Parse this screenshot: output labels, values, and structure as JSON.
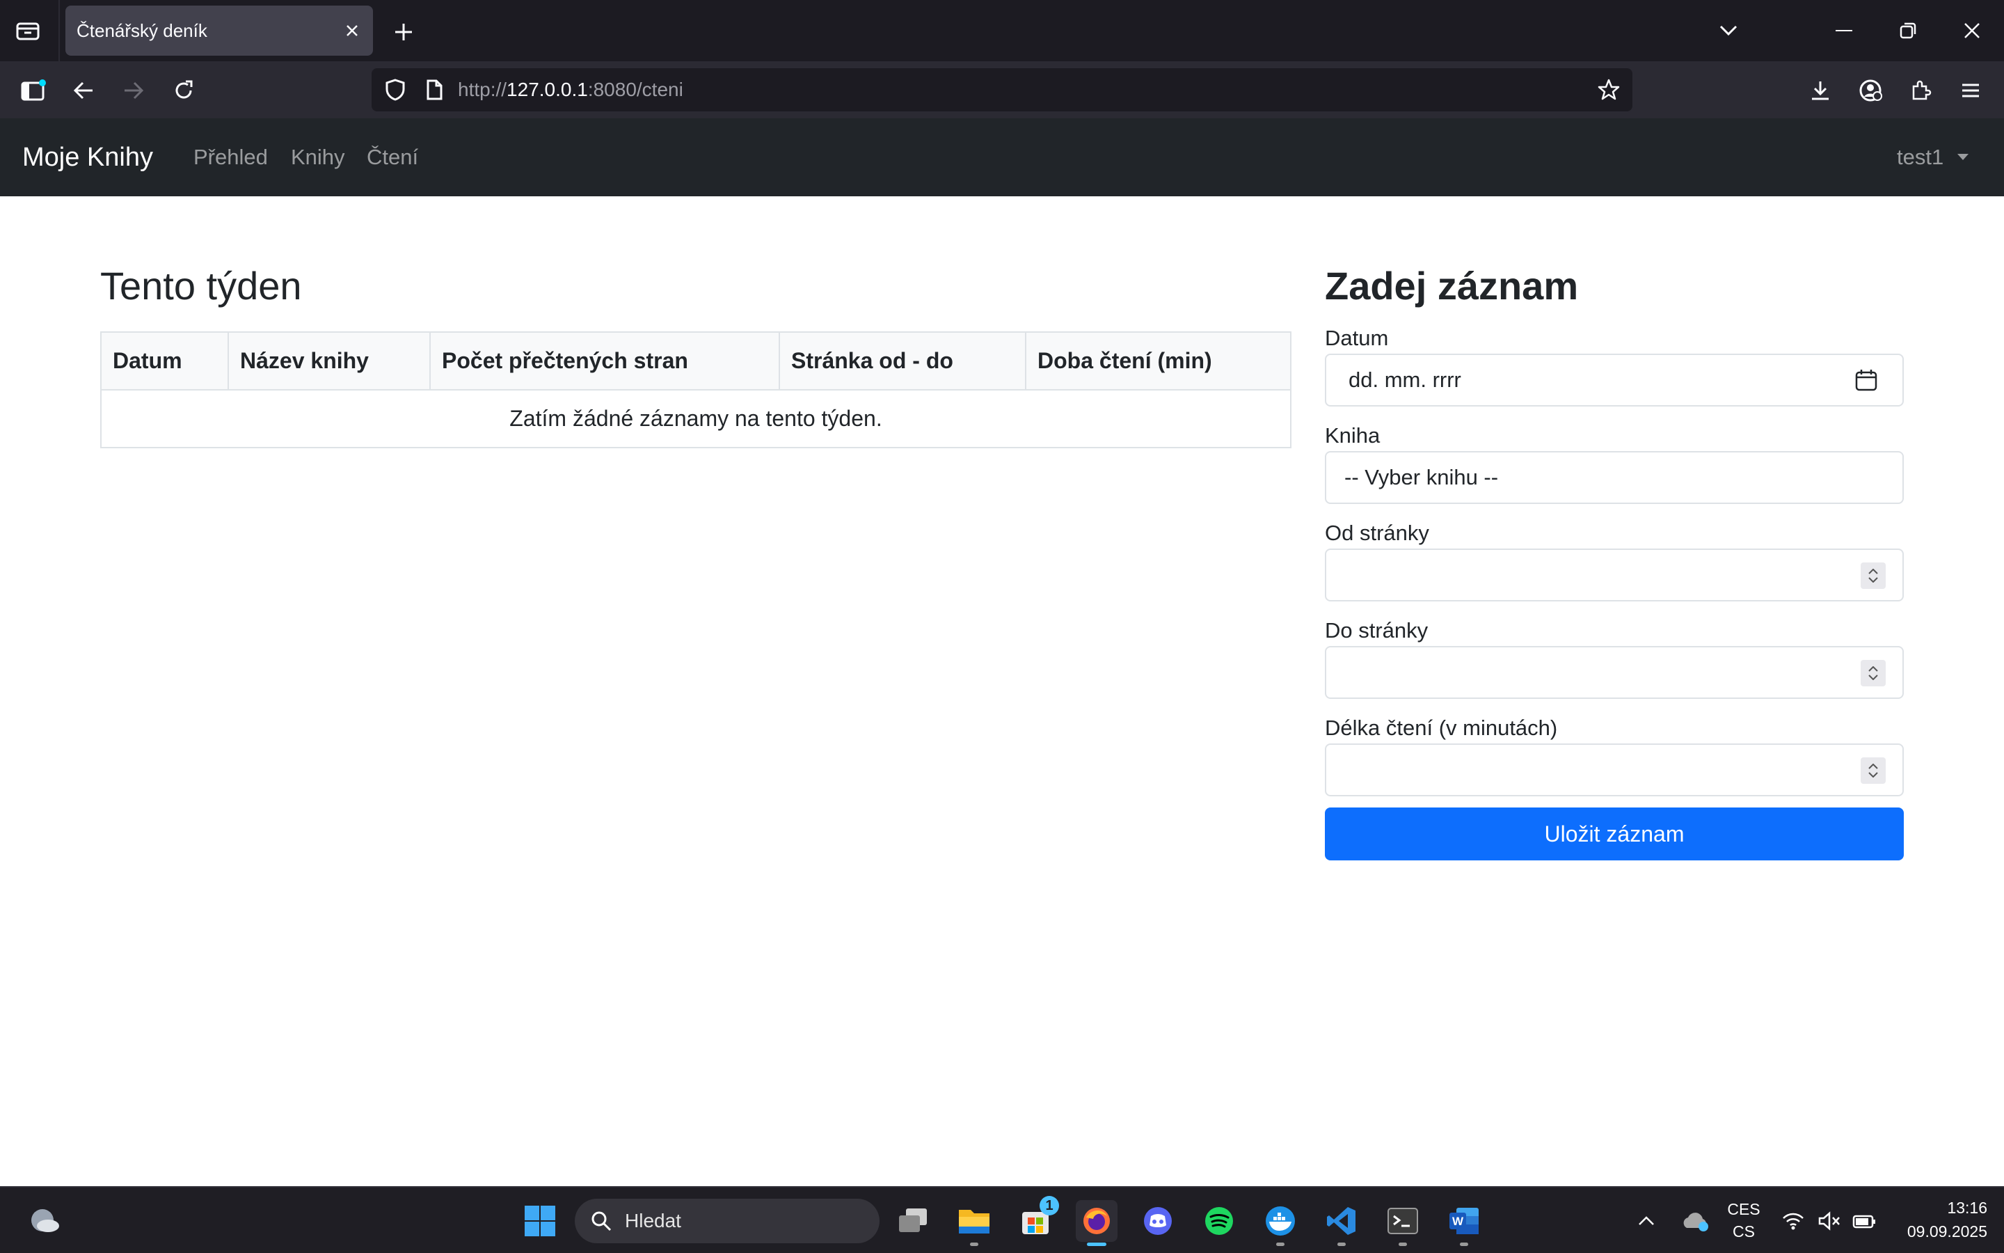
{
  "browser": {
    "tab_title": "Čtenářský deník",
    "url_prefix": "http://",
    "url_host": "127.0.0.1",
    "url_rest": ":8080/cteni"
  },
  "app": {
    "brand": "Moje Knihy",
    "nav": [
      "Přehled",
      "Knihy",
      "Čtení"
    ],
    "user": "test1"
  },
  "week": {
    "heading": "Tento týden",
    "columns": [
      "Datum",
      "Název knihy",
      "Počet přečtených stran",
      "Stránka od - do",
      "Doba čtení (min)"
    ],
    "empty_message": "Zatím žádné záznamy na tento týden."
  },
  "form": {
    "heading": "Zadej záznam",
    "date_label": "Datum",
    "date_placeholder": "dd. mm. rrrr",
    "book_label": "Kniha",
    "book_selected": "-- Vyber knihu --",
    "from_label": "Od stránky",
    "to_label": "Do stránky",
    "duration_label": "Délka čtení (v minutách)",
    "submit": "Uložit záznam"
  },
  "taskbar": {
    "search_placeholder": "Hledat",
    "store_badge": "1",
    "lang_top": "CES",
    "lang_bottom": "CS",
    "time": "13:16",
    "date": "09.09.2025"
  },
  "colors": {
    "primary": "#0d6efd",
    "navbar": "#212529",
    "browser_dark": "#1c1b22"
  }
}
